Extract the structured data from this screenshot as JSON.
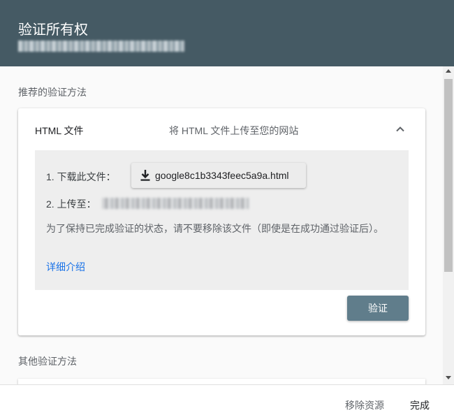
{
  "dialog": {
    "title": "验证所有权",
    "subtitle_redacted": true
  },
  "recommended": {
    "section_label": "推荐的验证方法",
    "method": {
      "name": "HTML 文件",
      "description": "将 HTML 文件上传至您的网站",
      "expanded": true
    },
    "steps": {
      "step1_label": "1. 下载此文件：",
      "download_filename": "google8c1b3343feec5a9a.html",
      "download_icon": "download-icon",
      "step2_label": "2. 上传至："
    },
    "note": "为了保持已完成验证的状态，请不要移除该文件（即使是在成功通过验证后）。",
    "learn_more": "详细介绍",
    "verify_button": "验证"
  },
  "other": {
    "section_label": "其他验证方法"
  },
  "footer": {
    "remove_label": "移除资源",
    "done_label": "完成"
  },
  "colors": {
    "header_bg": "#455a64",
    "verify_bg": "#607d8b",
    "link": "#1a73e8",
    "panel_bg": "#eeeeee"
  }
}
